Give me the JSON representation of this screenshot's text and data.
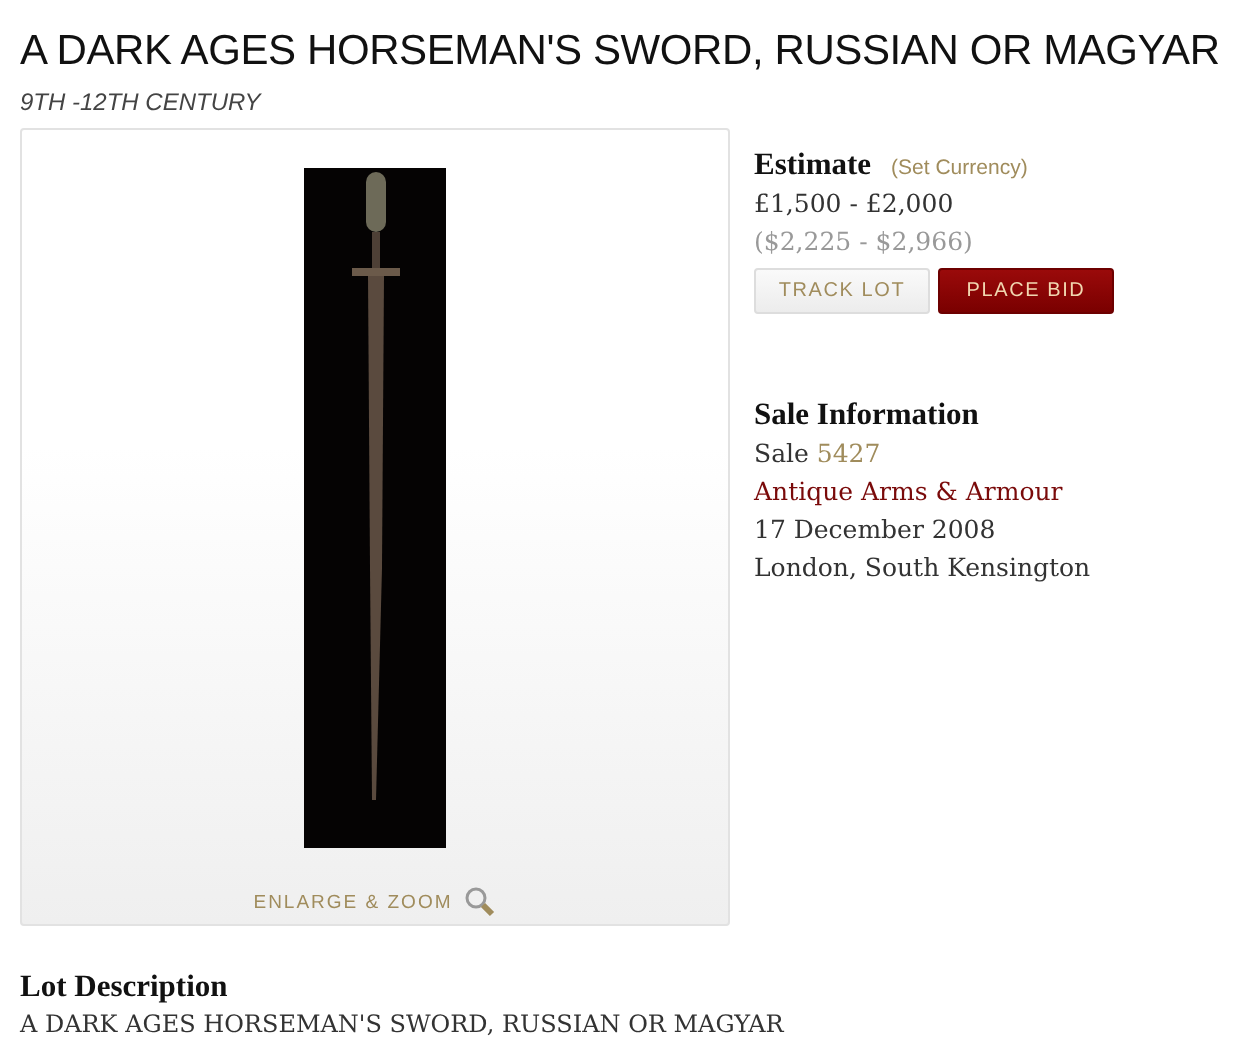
{
  "title": "A DARK AGES HORSEMAN'S SWORD, RUSSIAN OR MAGYAR",
  "subtitle": "9TH -12TH CENTURY",
  "image_panel": {
    "zoom_link": "ENLARGE & ZOOM"
  },
  "estimate": {
    "heading": "Estimate",
    "currency_link": "(Set Currency)",
    "price": "£1,500 - £2,000",
    "converted": "($2,225 - $2,966)",
    "buttons": [
      {
        "label": "TRACK LOT",
        "kind": "secondary"
      },
      {
        "label": "PLACE BID",
        "kind": "primary"
      }
    ]
  },
  "sale_information": {
    "heading": "Sale Information",
    "sale_label": "Sale",
    "sale_number": "5427",
    "sale_name": "Antique Arms & Armour",
    "date": "17 December 2008",
    "location": "London, South Kensington"
  },
  "lot_description": {
    "heading": "Lot Description",
    "text": "A DARK AGES HORSEMAN'S SWORD, RUSSIAN OR MAGYAR"
  }
}
